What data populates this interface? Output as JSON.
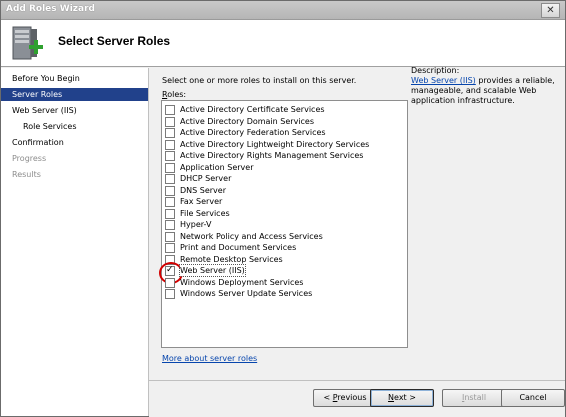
{
  "window": {
    "title": "Add Roles Wizard",
    "close_glyph": "✕"
  },
  "header": {
    "title": "Select Server Roles",
    "icon": "server-add-icon"
  },
  "nav": {
    "items": [
      {
        "label": "Before You Begin",
        "state": "normal",
        "indent": false
      },
      {
        "label": "Server Roles",
        "state": "selected",
        "indent": false
      },
      {
        "label": "Web Server (IIS)",
        "state": "normal",
        "indent": false
      },
      {
        "label": "Role Services",
        "state": "normal",
        "indent": true
      },
      {
        "label": "Confirmation",
        "state": "normal",
        "indent": false
      },
      {
        "label": "Progress",
        "state": "disabled",
        "indent": false
      },
      {
        "label": "Results",
        "state": "disabled",
        "indent": false
      }
    ]
  },
  "main": {
    "prompt": "Select one or more roles to install on this server.",
    "roles_label_first": "R",
    "roles_label_rest": "oles:",
    "roles": [
      {
        "label": "Active Directory Certificate Services",
        "checked": false
      },
      {
        "label": "Active Directory Domain Services",
        "checked": false
      },
      {
        "label": "Active Directory Federation Services",
        "checked": false
      },
      {
        "label": "Active Directory Lightweight Directory Services",
        "checked": false
      },
      {
        "label": "Active Directory Rights Management Services",
        "checked": false
      },
      {
        "label": "Application Server",
        "checked": false
      },
      {
        "label": "DHCP Server",
        "checked": false
      },
      {
        "label": "DNS Server",
        "checked": false
      },
      {
        "label": "Fax Server",
        "checked": false
      },
      {
        "label": "File Services",
        "checked": false
      },
      {
        "label": "Hyper-V",
        "checked": false
      },
      {
        "label": "Network Policy and Access Services",
        "checked": false
      },
      {
        "label": "Print and Document Services",
        "checked": false
      },
      {
        "label": "Remote Desktop Services",
        "checked": false
      },
      {
        "label": "Web Server (IIS)",
        "checked": true
      },
      {
        "label": "Windows Deployment Services",
        "checked": false
      },
      {
        "label": "Windows Server Update Services",
        "checked": false
      }
    ],
    "check_glyph": "✓",
    "description_label": "Description:",
    "description_link": "Web Server (IIS)",
    "description_text": " provides a reliable, manageable, and scalable Web application infrastructure.",
    "more_link": "More about server roles"
  },
  "buttons": {
    "previous_ul": "P",
    "previous_rest": "revious",
    "previous_prefix": "< ",
    "next_ul": "N",
    "next_rest": "ext",
    "next_suffix": " >",
    "install_ul": "I",
    "install_rest": "nstall",
    "cancel": "Cancel"
  },
  "colors": {
    "nav_selected": "#21418b",
    "link": "#0645ad",
    "highlight_circle": "#d20000"
  }
}
